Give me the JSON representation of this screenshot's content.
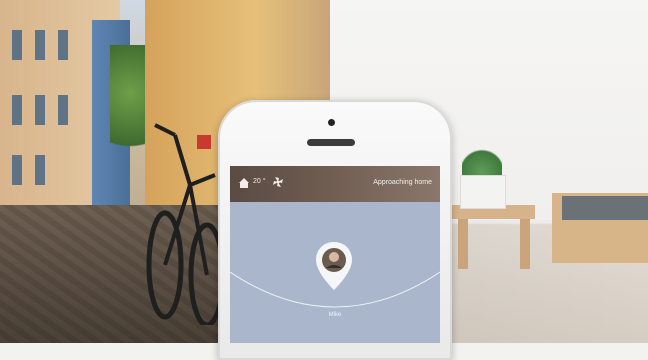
{
  "app": {
    "status_bar": {
      "temperature": "20 °",
      "title": "Approaching home"
    },
    "map": {
      "pin_label": "Mike"
    }
  },
  "icons": {
    "home": "home-icon",
    "fan": "fan-icon",
    "avatar_pin": "location-pin-icon"
  },
  "colors": {
    "screen_bg": "#a9b6cc",
    "status_bar": "#5a4b43",
    "pin": "#f4f6f8"
  }
}
